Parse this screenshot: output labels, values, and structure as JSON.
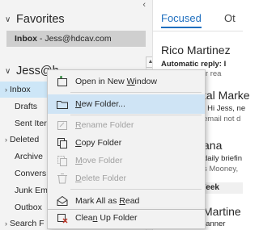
{
  "nav": {
    "favorites_label": "Favorites",
    "fav_inbox_bold": "Inbox",
    "fav_inbox_rest": " - Jess@hdcav.com",
    "account_label": "Jess@h",
    "folders": [
      {
        "label": "Inbox",
        "expanded": true
      },
      {
        "label": "Drafts"
      },
      {
        "label": "Sent Iter"
      },
      {
        "label": "Deleted"
      },
      {
        "label": "Archive"
      },
      {
        "label": "Convers"
      },
      {
        "label": "Junk Em"
      },
      {
        "label": "Outbox"
      },
      {
        "label": "Search F"
      }
    ]
  },
  "tabs": {
    "focused": "Focused",
    "other": "Ot"
  },
  "messages": {
    "m1_sender": "Rico Martinez",
    "m1_bold": "Automatic reply: I",
    "m1_preview": "Thank you for rea",
    "m2_sender": "tal Marke",
    "m2_line": "| Hi Jess, ne",
    "m2_preview": "email not d",
    "m3_sender": "ana",
    "m3_line": "daily briefin",
    "m3_preview": "s Mooney,",
    "week_label": "Week",
    "m4_sender": "Martine",
    "m4_line": "ranner"
  },
  "menu": {
    "items": [
      {
        "pre": "Open in New ",
        "ul": "W",
        "post": "indow",
        "icon": "open-window-icon",
        "disabled": false
      },
      {
        "pre": "",
        "ul": "N",
        "post": "ew Folder...",
        "icon": "new-folder-icon",
        "disabled": false,
        "hover": true
      },
      {
        "pre": "",
        "ul": "R",
        "post": "ename Folder",
        "icon": "rename-folder-icon",
        "disabled": true
      },
      {
        "pre": "",
        "ul": "C",
        "post": "opy Folder",
        "icon": "copy-folder-icon",
        "disabled": false
      },
      {
        "pre": "",
        "ul": "M",
        "post": "ove Folder",
        "icon": "move-folder-icon",
        "disabled": true
      },
      {
        "pre": "",
        "ul": "D",
        "post": "elete Folder",
        "icon": "delete-folder-icon",
        "disabled": true
      },
      {
        "pre": "Mark All as ",
        "ul": "R",
        "post": "ead",
        "icon": "mark-all-read-icon",
        "disabled": false
      },
      {
        "pre": "Clea",
        "ul": "n",
        "post": " Up Folder",
        "icon": "clean-up-folder-icon",
        "disabled": false
      }
    ]
  },
  "colors": {
    "accent": "#1f6fbf",
    "selection": "#cde6f7",
    "hover": "#cfe4f5",
    "menu_bg": "#f2f2f2"
  }
}
